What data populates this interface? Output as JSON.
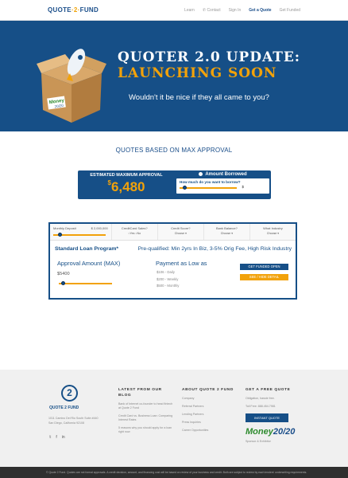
{
  "nav": {
    "logo_part1": "QUOTE",
    "logo_part2": "2",
    "logo_part3": "FUND",
    "items": [
      "Learn",
      "Contact",
      "Sign In",
      "Get a Quote",
      "Get Funded"
    ]
  },
  "hero": {
    "title": "QUOTER 2.0 UPDATE:",
    "subtitle": "LAUNCHING SOON",
    "tagline": "Wouldn't it be nice if they all came to you?",
    "box_label_1": "Money",
    "box_label_2": "20/20"
  },
  "quotes": {
    "heading": "QUOTES BASED ON MAX APPROVAL",
    "estimated_label": "ESTIMATED MAXIMUM APPROVAL",
    "estimated_currency": "$",
    "estimated_value": "6,480",
    "amount_borrowed": "Amount Borrowed",
    "borrow_question": "How much do you want to borrow?",
    "borrow_value": "$",
    "borrow_level": 0.05
  },
  "panel": {
    "filters": [
      {
        "label": "Monthly Deposit",
        "value": "$ 2,000,000"
      },
      {
        "label": "CreditCard Sales?",
        "opt1": "Yes",
        "opt2": "No"
      },
      {
        "label": "Credit Score?",
        "value": "Choose"
      },
      {
        "label": "Bank Balance?",
        "value": "Choose"
      },
      {
        "label": "What Industry",
        "value": "Choose"
      }
    ],
    "plan_name": "Standard Loan Program*",
    "prequal": "Pre-qualified: Min 2yrs In Biz, 3-5% Orig Fee, High Risk Industry",
    "approval_label": "Approval Amount (MAX)",
    "approval_value": "$5400",
    "approval_level": 0.05,
    "payment_label": "Payment as Low as",
    "payments": [
      "$106 - Daily",
      "$200 - Weekly",
      "$500 - Monthly"
    ],
    "get_funded": "GET FUNDED OPEN",
    "hide_detail": "SEE / HIDE DETAIL"
  },
  "footer": {
    "logo_mark": "2",
    "logo_name": "QUOTE 2 FUND",
    "address_1": "1011 Camino Del Rio South Suite #440",
    "address_2": "San Diego, California 92108",
    "social": [
      "t-icon",
      "f-icon",
      "in-icon"
    ],
    "col1_title": "LATEST FROM OUR BLOG",
    "col1_items": [
      "Bank of Internet co-founder to head fintech at Quote 2 Fund",
      "Credit Card vs. Business Loan: Comparing Interest Rates",
      "5 reasons why you should apply for a loan right now"
    ],
    "col2_title": "ABOUT QUOTE 2 FUND",
    "col2_items": [
      "Company",
      "Referral Partners",
      "Lending Partners",
      "Press Inquiries",
      "Career Opportunities"
    ],
    "col3_title": "GET A FREE QUOTE",
    "col3_items": [
      "Obligation, hassle free.",
      "Toll Free: 888.454.7981"
    ],
    "instant_quote": "INSTANT QUOTE",
    "money_1": "Money",
    "money_2": "20/20",
    "sponsor": "Sponsor & Exhibitor"
  },
  "bottom_bar": "© Quote 2 Fund. Quotes are not formal approvals. A credit decision, amount, and financing cost will be based on review of your business and credit. Both are subject to review by each lenders' underwriting requirements.",
  "colors": {
    "brand_blue": "#164f87",
    "accent_orange": "#f2a20a"
  }
}
